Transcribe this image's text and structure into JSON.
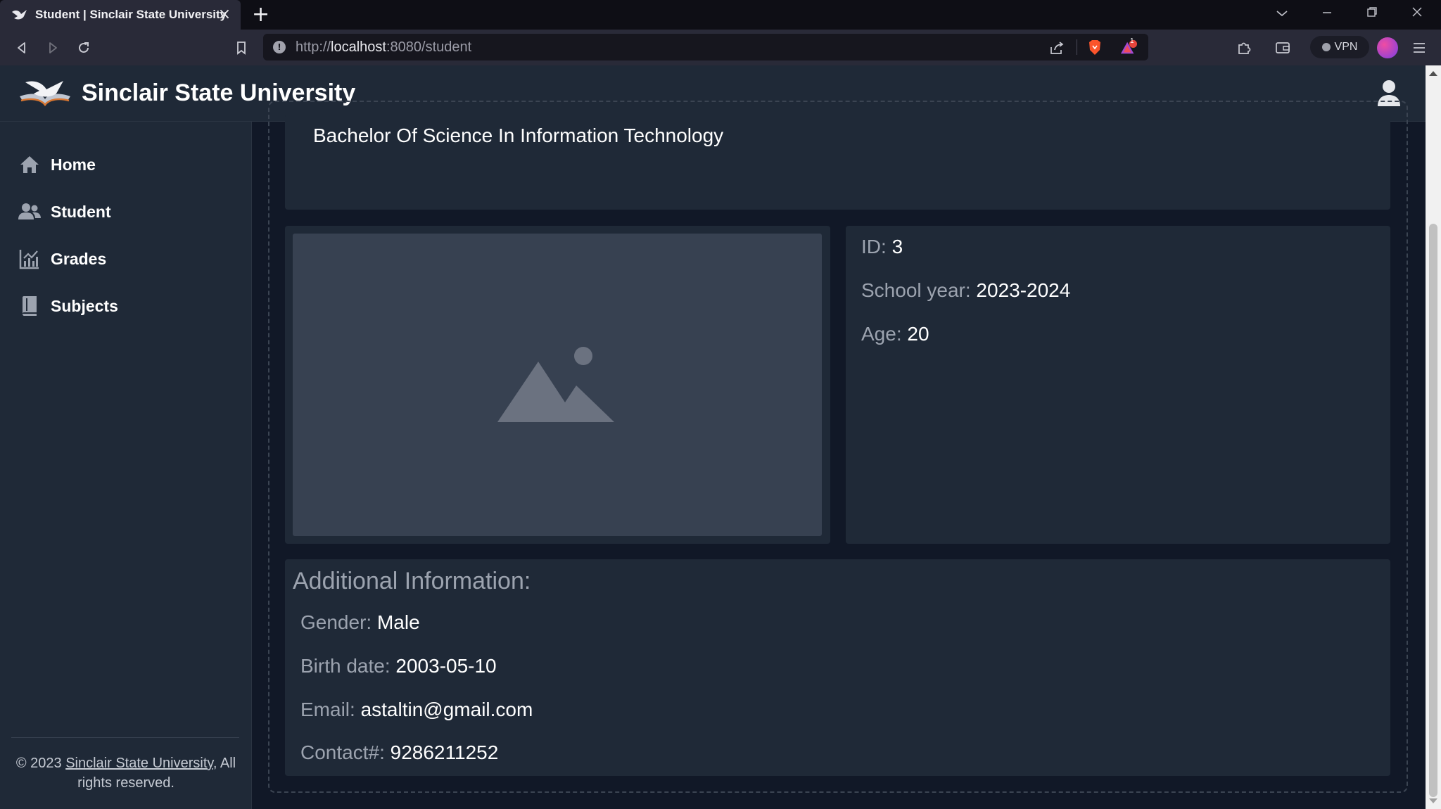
{
  "browser": {
    "tab_title": "Student | Sinclair State University",
    "tab_close": "×",
    "new_tab": "+",
    "url_scheme": "http://",
    "url_host": "localhost",
    "url_path": ":8080/student",
    "shield_badge": "1",
    "vpn_label": "VPN"
  },
  "header": {
    "brand": "Sinclair State University"
  },
  "sidebar": {
    "items": [
      {
        "label": "Home",
        "icon": "home-icon"
      },
      {
        "label": "Student",
        "icon": "users-icon"
      },
      {
        "label": "Grades",
        "icon": "chart-icon"
      },
      {
        "label": "Subjects",
        "icon": "book-icon"
      }
    ],
    "footer_prefix": "© 2023 ",
    "footer_link": "Sinclair State University",
    "footer_suffix": ", All rights reserved."
  },
  "student": {
    "program": "Bachelor Of Science In Information Technology",
    "id_label": "ID: ",
    "id_value": "3",
    "school_year_label": "School year: ",
    "school_year_value": "2023-2024",
    "age_label": "Age: ",
    "age_value": "20",
    "additional_title": "Additional Information:",
    "gender_label": "Gender: ",
    "gender_value": "Male",
    "birth_label": "Birth date: ",
    "birth_value": "2003-05-10",
    "email_label": "Email: ",
    "email_value": "astaltin@gmail.com",
    "contact_label": "Contact#: ",
    "contact_value": "9286211252"
  },
  "colors": {
    "sidebar_bg": "#1f2937",
    "main_bg": "#111827",
    "card_bg": "#1f2937",
    "label_gray": "#9ca3af"
  }
}
